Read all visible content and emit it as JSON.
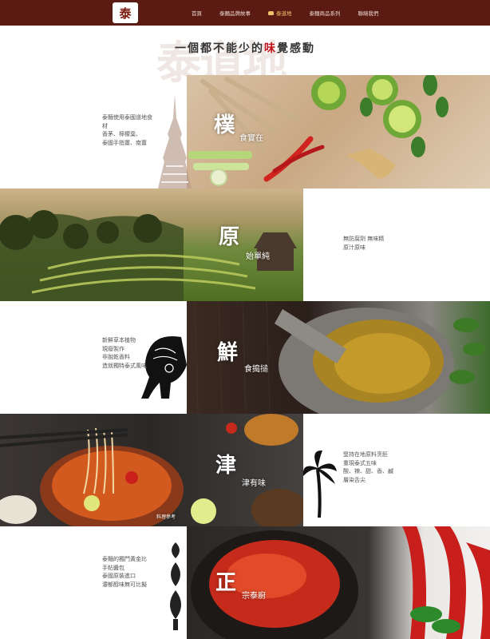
{
  "nav": {
    "logo_text": "泰",
    "items": [
      {
        "label": "首頁",
        "active": false
      },
      {
        "label": "泰麵品牌故事",
        "active": false
      },
      {
        "label": "泰道地",
        "active": true
      },
      {
        "label": "泰麵商品系列",
        "active": false
      },
      {
        "label": "聯絡我們",
        "active": false
      }
    ],
    "colors": {
      "bar": "#5b1a12",
      "active": "#f1c36a"
    }
  },
  "hero": {
    "watermark": "泰道地",
    "title_pre": "一個都不能少的",
    "title_accent": "味",
    "title_post": "覺感動",
    "accent_color": "#c0141c"
  },
  "sections": [
    {
      "big": "樸",
      "small": "食實在",
      "lines": [
        "泰麵使用泰國道地食",
        "材",
        "香茅、檸檬葉、",
        "泰國手指薑、南薑"
      ]
    },
    {
      "big": "原",
      "small": "始單純",
      "lines": [
        "無防腐劑 無味精",
        "原汁原味"
      ]
    },
    {
      "big": "鮮",
      "small": "食搗搥",
      "lines": [
        "新鮮草本植物",
        "現廢製作",
        "非脫乾香料",
        "造就獨特泰式風味"
      ]
    },
    {
      "big": "津",
      "small": "津有味",
      "caption": "料理參考",
      "lines": [
        "堅持在地原料烹飪",
        "重現泰式五味",
        "酸、辣、甜、香、鹹",
        "層染舌尖"
      ]
    },
    {
      "big": "正",
      "small": "宗泰廚",
      "lines": [
        "泰麵的獨門黃金比",
        "手帖醬包",
        "泰國原裝進口",
        "濃郁醇味無可比擬"
      ]
    }
  ]
}
